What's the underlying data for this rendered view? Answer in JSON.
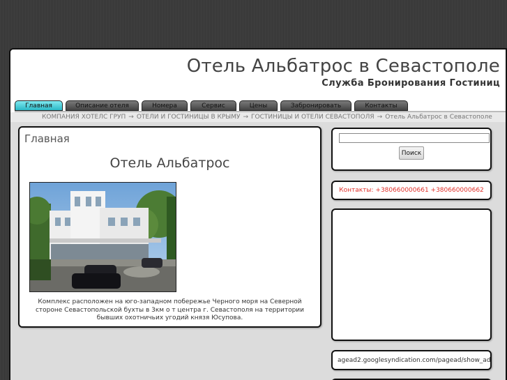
{
  "header": {
    "title": "Отель Альбатрос в Севастополе",
    "subtitle": "Служба Бронирования Гостиниц"
  },
  "nav": {
    "items": [
      {
        "label": "Главная",
        "active": true
      },
      {
        "label": "Описание отеля"
      },
      {
        "label": "Номера"
      },
      {
        "label": "Сервис"
      },
      {
        "label": "Цены"
      },
      {
        "label": "Забронировать"
      },
      {
        "label": "Контакты"
      }
    ]
  },
  "breadcrumb": {
    "items": [
      "КОМПАНИЯ ХОТЕЛС ГРУП",
      "ОТЕЛИ И ГОСТИНИЦЫ В КРЫМУ",
      "ГОСТИНИЦЫ И ОТЕЛИ СЕВАСТОПОЛЯ",
      "Отель Альбатрос в Севастополе"
    ],
    "separator": "→"
  },
  "main": {
    "heading": "Главная",
    "hotel_title": "Отель Альбатрос",
    "photo_icon": "hotel-photo",
    "description": "Комплекс расположен на юго-западном побережье Черного моря на Северной стороне Севастопольской бухты в 3км о т центра г. Севастополя на территории бывших охотничьих угодий князя Юсупова."
  },
  "sidebar": {
    "search": {
      "value": "",
      "button_label": "Поиск"
    },
    "contacts": "Контакты: +380660000661 +380660000662",
    "ad_url": "agead2.googlesyndication.com/pagead/show_ad"
  },
  "colors": {
    "nav_active": "#2bb8c6",
    "contact_text": "#e0302a",
    "page_bg": "#3a3a3a"
  }
}
